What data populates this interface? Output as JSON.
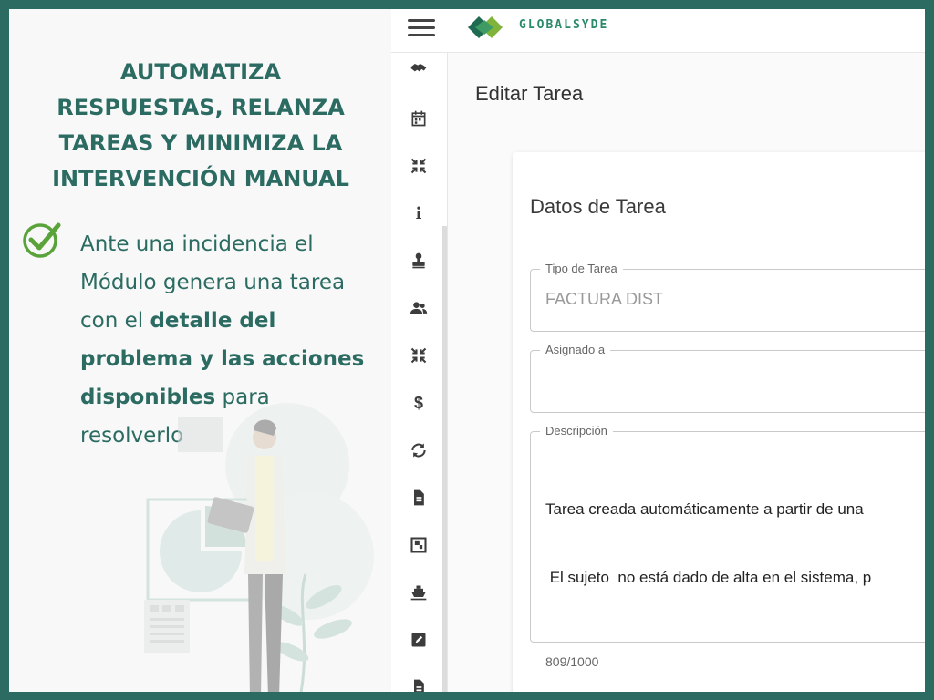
{
  "promo": {
    "title_lines": [
      "AUTOMATIZA",
      "RESPUESTAS, RELANZA",
      "TAREAS Y MINIMIZA LA",
      "INTERVENCIÓN MANUAL"
    ],
    "body_lines": [
      {
        "text": "Ante una incidencia el"
      },
      {
        "text": "Módulo genera una tarea"
      },
      {
        "prefix": "con el ",
        "bold": "detalle del"
      },
      {
        "bold": "problema y las acciones"
      },
      {
        "bold": "disponibles",
        "suffix": " para"
      },
      {
        "text": "resolverlo"
      }
    ],
    "accent_color": "#2b6b62",
    "check_color": "#5aa23a"
  },
  "app": {
    "brand": "GLOBALSYDE",
    "page_title": "Editar Tarea",
    "card_title": "Datos de Tarea",
    "fields": {
      "tipo_label": "Tipo de Tarea",
      "tipo_value": "FACTURA DIST",
      "asignado_label": "Asignado a",
      "asignado_value": "",
      "descripcion_label": "Descripción",
      "descripcion_line1": "Tarea creada automáticamente a partir de una",
      "descripcion_line2": " El sujeto  no está dado de alta en el sistema, p",
      "counter": "809/1000"
    },
    "sidebar_icons": [
      "handshake-icon",
      "calendar-icon",
      "collapse-icon",
      "info-icon",
      "stamp-icon",
      "group-icon",
      "collapse-icon",
      "dollar-icon",
      "refresh-icon",
      "document-icon",
      "frame-icon",
      "ship-icon",
      "edit-icon",
      "document-icon"
    ],
    "info_glyph": "i",
    "dollar_glyph": "$"
  }
}
